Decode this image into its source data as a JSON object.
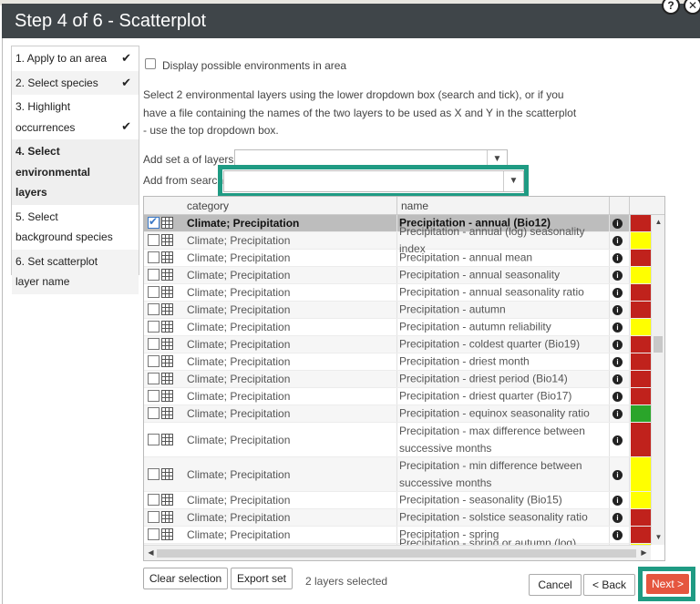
{
  "dialog": {
    "title": "Step 4 of 6 - Scatterplot",
    "help_glyph": "?",
    "close_glyph": "✕"
  },
  "steps": [
    {
      "label": "1. Apply to an area",
      "done": true
    },
    {
      "label": "2. Select species",
      "done": true
    },
    {
      "label": "3. Highlight occurrences",
      "done": true
    },
    {
      "label": "4. Select environmental layers",
      "active": true
    },
    {
      "label": "5. Select background species"
    },
    {
      "label": "6. Set scatterplot layer name"
    }
  ],
  "check_glyph": "✔",
  "options": {
    "display_env_label": "Display possible environments in area"
  },
  "instructions": "Select 2 environmental layers using the lower dropdown box (search and tick), or if you have a file containing the names of the two layers to be used as X and Y in the scatterplot - use the top dropdown box.",
  "fields": {
    "add_set_label": "Add set a of layers:",
    "add_search_label": "Add from search:"
  },
  "table": {
    "headers": {
      "category": "category",
      "name": "name"
    },
    "rows": [
      {
        "category": "Climate; Precipitation",
        "name": "Precipitation - annual (Bio12)",
        "checked": true,
        "color": "#c0221c"
      },
      {
        "category": "Climate; Precipitation",
        "name": "Precipitation - annual (log) seasonality index",
        "color": "#ffff00"
      },
      {
        "category": "Climate; Precipitation",
        "name": "Precipitation - annual mean",
        "color": "#c0221c"
      },
      {
        "category": "Climate; Precipitation",
        "name": "Precipitation - annual seasonality",
        "color": "#ffff00"
      },
      {
        "category": "Climate; Precipitation",
        "name": "Precipitation - annual seasonality ratio",
        "color": "#c0221c"
      },
      {
        "category": "Climate; Precipitation",
        "name": "Precipitation - autumn",
        "color": "#c0221c"
      },
      {
        "category": "Climate; Precipitation",
        "name": "Precipitation - autumn reliability",
        "color": "#ffff00"
      },
      {
        "category": "Climate; Precipitation",
        "name": "Precipitation - coldest quarter (Bio19)",
        "color": "#c0221c"
      },
      {
        "category": "Climate; Precipitation",
        "name": "Precipitation - driest month",
        "color": "#c0221c"
      },
      {
        "category": "Climate; Precipitation",
        "name": "Precipitation - driest period (Bio14)",
        "color": "#c0221c"
      },
      {
        "category": "Climate; Precipitation",
        "name": "Precipitation - driest quarter (Bio17)",
        "color": "#c0221c"
      },
      {
        "category": "Climate; Precipitation",
        "name": "Precipitation - equinox seasonality ratio",
        "color": "#2aa52a"
      },
      {
        "category": "Climate; Precipitation",
        "name": "Precipitation - max difference between successive months",
        "color": "#c0221c",
        "tall": true
      },
      {
        "category": "Climate; Precipitation",
        "name": "Precipitation - min difference between successive months",
        "color": "#ffff00",
        "tall": true
      },
      {
        "category": "Climate; Precipitation",
        "name": "Precipitation - seasonality (Bio15)",
        "color": "#ffff00"
      },
      {
        "category": "Climate; Precipitation",
        "name": "Precipitation - solstice seasonality ratio",
        "color": "#c0221c"
      },
      {
        "category": "Climate; Precipitation",
        "name": "Precipitation - spring",
        "color": "#c0221c"
      },
      {
        "category": "Climate; Precipitation",
        "name": "Precipitation - spring or autumn (log) season",
        "color": "#ffff00"
      }
    ],
    "info_glyph": "i"
  },
  "footer": {
    "clear_label": "Clear selection",
    "export_label": "Export set",
    "selected_text": "2 layers selected",
    "cancel_label": "Cancel",
    "back_label": "< Back",
    "next_label": "Next >"
  }
}
